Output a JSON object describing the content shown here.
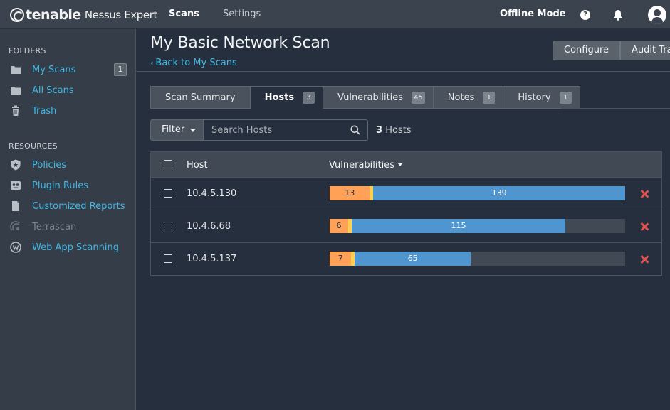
{
  "topbar": {
    "brand": "tenable",
    "product": "Nessus Expert",
    "nav": [
      {
        "label": "Scans",
        "active": true
      },
      {
        "label": "Settings",
        "active": false
      }
    ],
    "mode": "Offline Mode",
    "help_icon": "help-circle-icon",
    "help_glyph": "?",
    "notifications_icon": "bell-icon",
    "user_icon": "user-avatar-icon"
  },
  "sidebar": {
    "folders_heading": "FOLDERS",
    "folders": [
      {
        "label": "My Scans",
        "icon": "folder-icon",
        "badge": "1"
      },
      {
        "label": "All Scans",
        "icon": "folder-icon"
      },
      {
        "label": "Trash",
        "icon": "trash-icon"
      }
    ],
    "resources_heading": "RESOURCES",
    "resources": [
      {
        "label": "Policies",
        "icon": "shield-icon"
      },
      {
        "label": "Plugin Rules",
        "icon": "plugin-icon"
      },
      {
        "label": "Customized Reports",
        "icon": "document-icon"
      },
      {
        "label": "Terrascan",
        "icon": "terrascan-icon",
        "disabled": true
      },
      {
        "label": "Web App Scanning",
        "icon": "web-app-icon"
      }
    ]
  },
  "page": {
    "title": "My Basic Network Scan",
    "back_link": "Back to My Scans",
    "buttons": [
      "Configure",
      "Audit Trail"
    ]
  },
  "tabs": [
    {
      "label": "Scan Summary"
    },
    {
      "label": "Hosts",
      "count": "3",
      "active": true
    },
    {
      "label": "Vulnerabilities",
      "count": "45"
    },
    {
      "label": "Notes",
      "count": "1"
    },
    {
      "label": "History",
      "count": "1"
    }
  ],
  "filter": {
    "label": "Filter",
    "search_placeholder": "Search Hosts",
    "hosts_count": "3",
    "hosts_label": "Hosts"
  },
  "table": {
    "columns": [
      "Host",
      "Vulnerabilities"
    ],
    "rows": [
      {
        "host": "10.4.5.130",
        "high": 13,
        "medium": 1,
        "info": 139
      },
      {
        "host": "10.4.6.68",
        "high": 6,
        "medium": 1,
        "info": 115
      },
      {
        "host": "10.4.5.137",
        "high": 7,
        "medium": 1,
        "info": 65
      }
    ]
  },
  "colors": {
    "high": "#ffa157",
    "medium": "#ffd04f",
    "info": "#4f95d0",
    "link": "#41b8e4",
    "delete": "#e05252"
  }
}
